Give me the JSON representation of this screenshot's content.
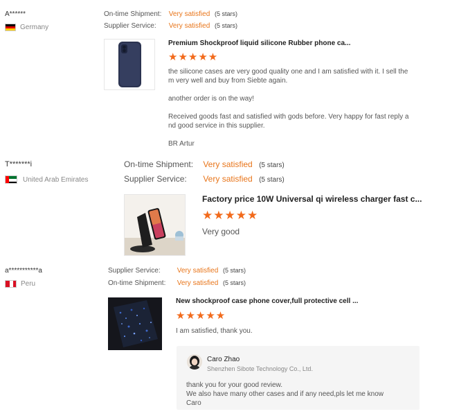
{
  "reviews": [
    {
      "name": "A******",
      "country": "Germany",
      "flag": "germany-flag",
      "ratings": [
        {
          "label": "On-time Shipment:",
          "value": "Very satisfied",
          "stars": "(5 stars)"
        },
        {
          "label": "Supplier Service:",
          "value": "Very satisfied",
          "stars": "(5 stars)"
        }
      ],
      "product_title": "Premium Shockproof liquid silicone Rubber phone ca...",
      "product_image": "navy-silicone-phone-case",
      "rating": 5,
      "stars_text": "★★★★★",
      "text_lines": [
        "the silicone cases are very good quality one and I am satisfied with it. I sell the",
        "m very well and buy from Siebte again.",
        "another order is on the way!",
        "Received goods fast and satisfied with gods before. Very happy for fast reply a",
        "nd good service in this supplier.",
        "BR Artur"
      ]
    },
    {
      "name": "T*******i",
      "country": "United Arab Emirates",
      "flag": "uae-flag",
      "ratings": [
        {
          "label": "On-time Shipment:",
          "value": "Very satisfied",
          "stars": "(5 stars)"
        },
        {
          "label": "Supplier Service:",
          "value": "Very satisfied",
          "stars": "(5 stars)"
        }
      ],
      "product_title": "Factory price 10W Universal qi wireless charger fast c...",
      "product_image": "wireless-charger-stand",
      "rating": 5,
      "stars_text": "★★★★★",
      "text_lines": [
        "Very good"
      ]
    },
    {
      "name": "a***********a",
      "country": "Peru",
      "flag": "peru-flag",
      "ratings": [
        {
          "label": "Supplier Service:",
          "value": "Very satisfied",
          "stars": "(5 stars)"
        },
        {
          "label": "On-time Shipment:",
          "value": "Very satisfied",
          "stars": "(5 stars)"
        }
      ],
      "product_title": "New shockproof case phone cover,full protective cell ...",
      "product_image": "starry-phone-cover",
      "rating": 5,
      "stars_text": "★★★★★",
      "text_lines": [
        "I am satisfied, thank you."
      ],
      "reply": {
        "name": "Caro Zhao",
        "company": "Shenzhen Sibote Technology Co., Ltd.",
        "lines": [
          "thank you for your good review.",
          "We also have many other cases and if any need,pls let me know",
          "Caro"
        ]
      }
    }
  ],
  "colors": {
    "accent": "#e8751a",
    "star": "#f26a1b",
    "reply_bg": "#f5f5f5"
  }
}
